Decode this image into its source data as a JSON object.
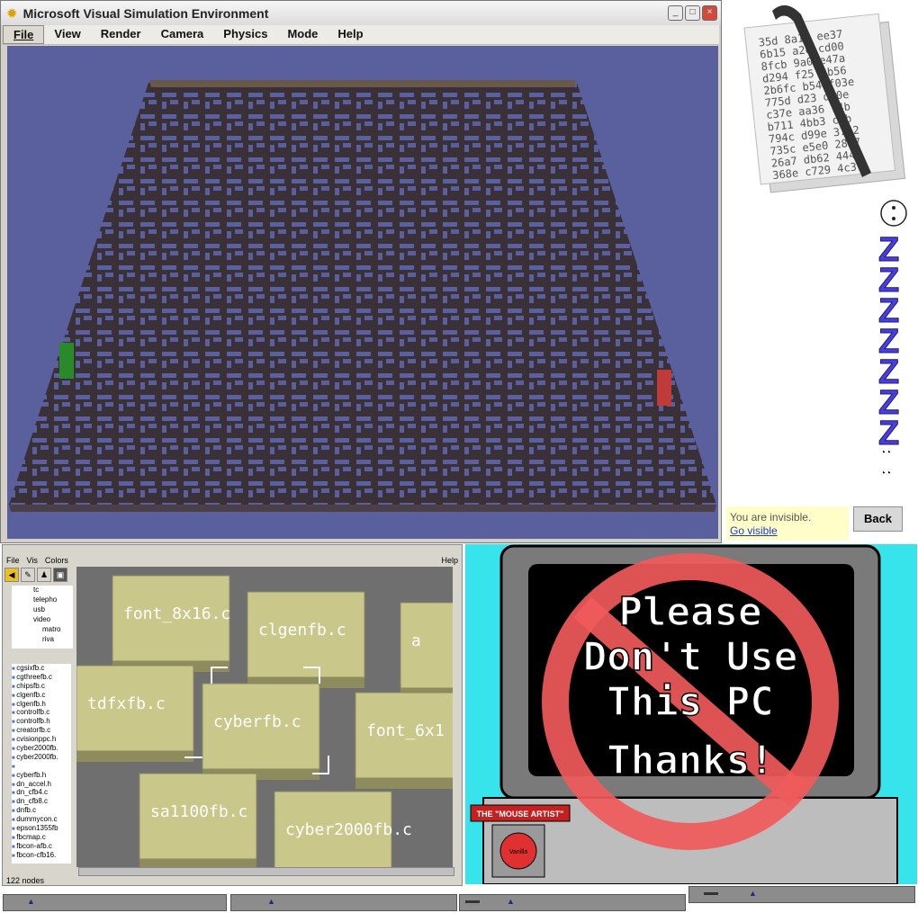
{
  "sim_window": {
    "title": "Microsoft Visual Simulation Environment",
    "menu": [
      "File",
      "View",
      "Render",
      "Camera",
      "Physics",
      "Mode",
      "Help"
    ],
    "controls": [
      "_",
      "□",
      "×"
    ]
  },
  "paper_icon": {
    "hex_lines": [
      "35d  8a10  ee37",
      "6b15  a2e  cd00",
      "8fcb  9a0  e47a",
      "d294  f25  2b56",
      "2b6fc b54  f03e",
      "775d  d23  d90e",
      "c37e  aa36  74b",
      "b711  4bb3  c9b",
      "794c  d99e  3742",
      "735c  e5e0  2837",
      "26a7  db62  444a",
      "368e  c729  4c3"
    ]
  },
  "visibility": {
    "status": "You are invisible.",
    "link": "Go visible",
    "back_button": "Back"
  },
  "file_viewer": {
    "menu": [
      "File",
      "Vis",
      "Colors"
    ],
    "help": "Help",
    "tree": [
      "tc",
      "telepho",
      "usb",
      "video",
      "matro",
      "riva"
    ],
    "list": [
      "cgsixfb.c",
      "cgthreefb.c",
      "chipsfb.c",
      "clgenfb.c",
      "clgenfb.h",
      "controlfb.c",
      "controlfb.h",
      "creatorfb.c",
      "cvisionppc.h",
      "cyber2000fb.",
      "cyber2000fb.",
      "",
      "cyberfb.h",
      "dn_accel.h",
      "dn_cfb4.c",
      "dn_cfb8.c",
      "dnfb.c",
      "dummycon.c",
      "epson1355fb",
      "fbcmap.c",
      "fbcon-afb.c",
      "fbcon-cfb16."
    ],
    "blocks": [
      "font_8x16.c",
      "clgenfb.c",
      "a",
      "tdfxfb.c",
      "cyberfb.c",
      "font_6x1",
      "sa1100fb.c",
      "cyber2000fb.c"
    ],
    "status": "122 nodes"
  },
  "pc_sign": {
    "lines": [
      "Please",
      "Don't Use",
      "This PC",
      "Thanks!"
    ],
    "artist_tag": "THE \"MOUSE ARTIST\"",
    "disk_label": "Vanilla"
  }
}
